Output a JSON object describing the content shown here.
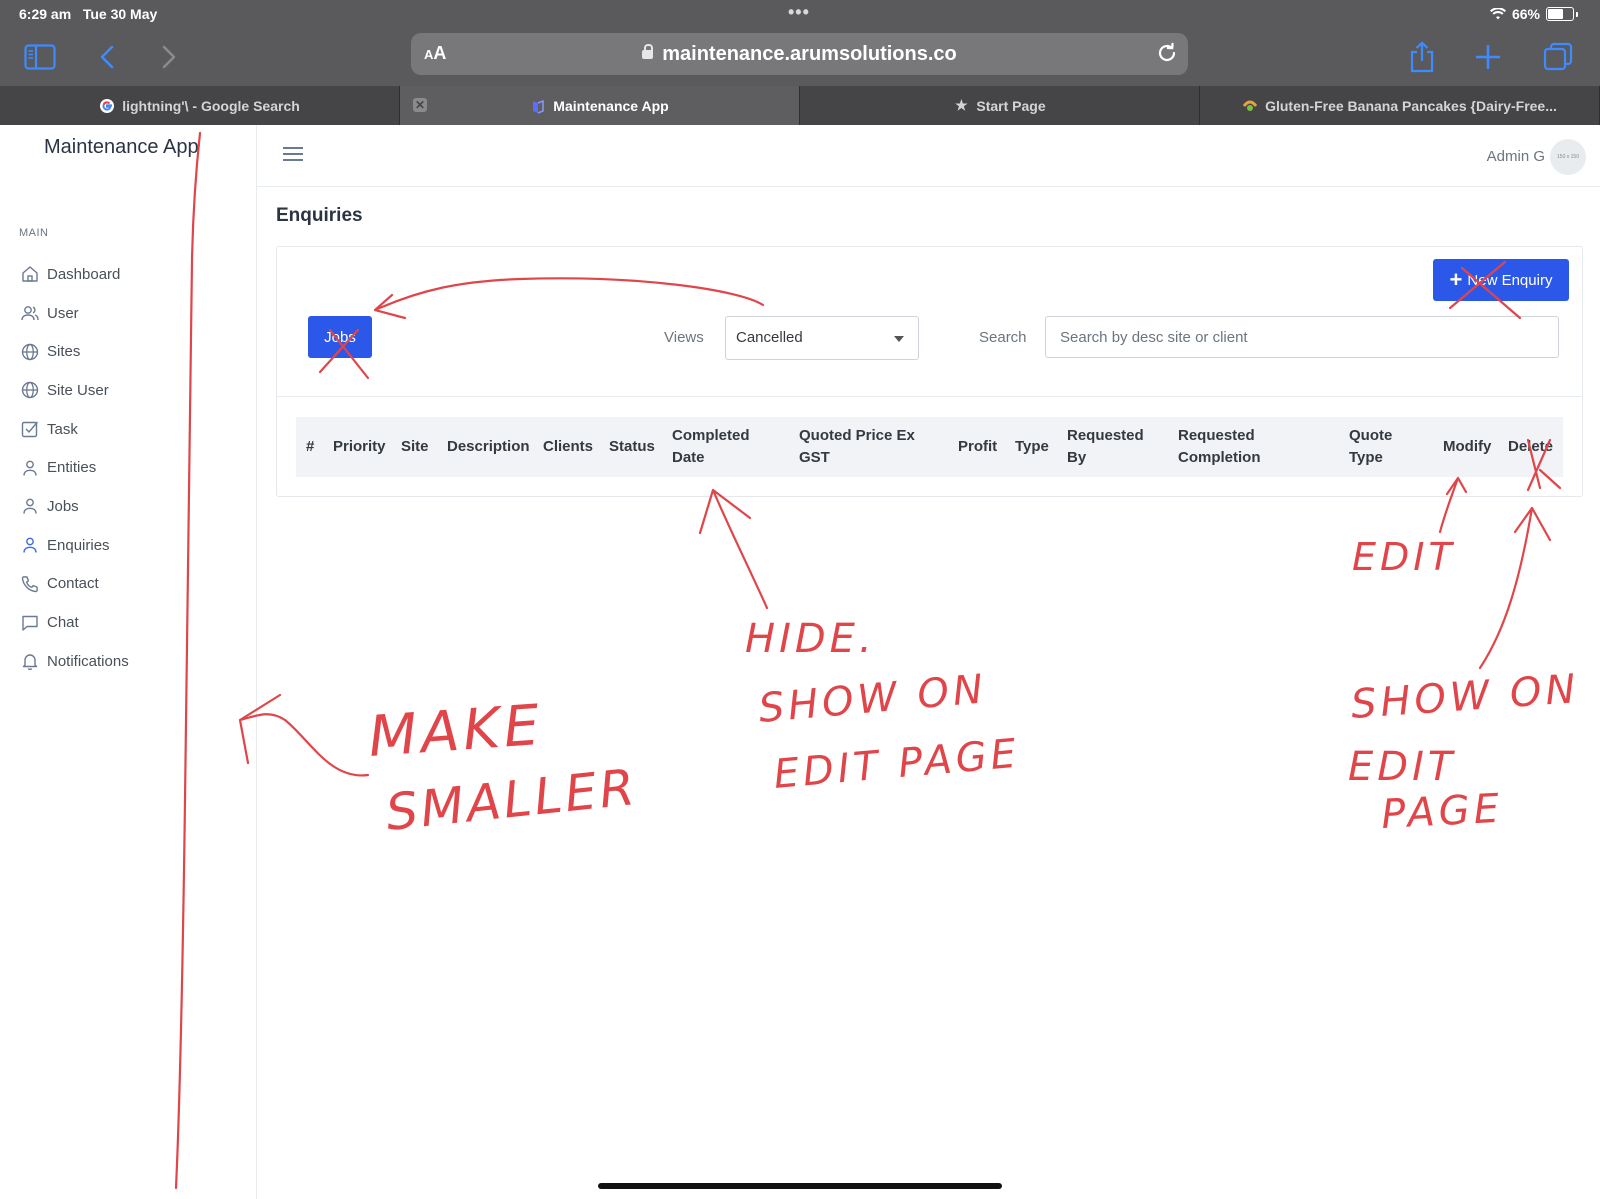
{
  "status_bar": {
    "time": "6:29 am",
    "date": "Tue 30 May",
    "battery": "66%",
    "battery_fraction": 0.66
  },
  "browser": {
    "aa_label": "AA",
    "url": "maintenance.arumsolutions.co",
    "tabs": [
      {
        "label": "lightning'\\ - Google Search",
        "icon": "google-favicon",
        "active": false
      },
      {
        "label": "Maintenance App",
        "icon": "app-favicon",
        "active": true
      },
      {
        "label": "Start Page",
        "icon": "star-icon",
        "active": false
      },
      {
        "label": "Gluten-Free Banana Pancakes {Dairy-Free...",
        "icon": "recipe-favicon",
        "active": false
      }
    ]
  },
  "sidebar": {
    "brand": "Maintenance App",
    "section": "MAIN",
    "items": [
      {
        "label": "Dashboard",
        "icon": "home-icon"
      },
      {
        "label": "User",
        "icon": "users-icon"
      },
      {
        "label": "Sites",
        "icon": "globe-icon"
      },
      {
        "label": "Site User",
        "icon": "globe-icon"
      },
      {
        "label": "Task",
        "icon": "checkbox-icon"
      },
      {
        "label": "Entities",
        "icon": "user-icon"
      },
      {
        "label": "Jobs",
        "icon": "user-icon"
      },
      {
        "label": "Enquiries",
        "icon": "user-icon"
      },
      {
        "label": "Contact",
        "icon": "phone-icon"
      },
      {
        "label": "Chat",
        "icon": "chat-icon"
      },
      {
        "label": "Notifications",
        "icon": "bell-icon"
      }
    ]
  },
  "header": {
    "user_name": "Admin G",
    "avatar_text": "150 x 150"
  },
  "main": {
    "title": "Enquiries",
    "new_button": "New Enquiry",
    "jobs_button": "Jobs",
    "views_label": "Views",
    "views_value": "Cancelled",
    "search_label": "Search",
    "search_placeholder": "Search by desc site or client",
    "columns": [
      "#",
      "Priority",
      "Site",
      "Description",
      "Clients",
      "Status",
      "Completed Date",
      "Quoted Price Ex GST",
      "Profit",
      "Type",
      "Requested By",
      "Requested Completion",
      "Quote Type",
      "Modify",
      "Delete"
    ]
  },
  "annotations": {
    "make_smaller_1": "MAKE",
    "make_smaller_2": "SMALLER",
    "hide": "HIDE.",
    "show_on_1": "SHOW ON",
    "show_on_2": "EDIT PAGE",
    "edit": "EDIT",
    "show_on_3": "SHOW ON",
    "show_on_4": "EDIT",
    "show_on_5": "PAGE",
    "ink_color": "#e0454a"
  },
  "colors": {
    "primary": "#2c58ea",
    "chrome": "#5a5a5c",
    "tab_bar": "#454547"
  }
}
